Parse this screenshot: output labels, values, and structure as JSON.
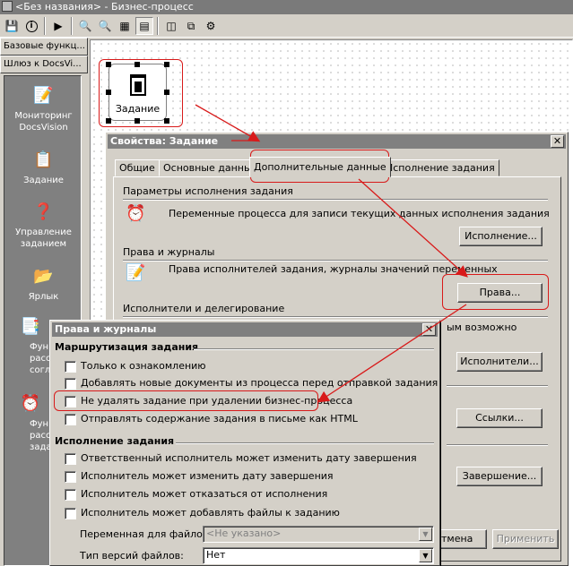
{
  "window": {
    "title": "<Без названия> - Бизнес-процесс"
  },
  "toolbar": {
    "buttons": [
      "save-icon",
      "info-icon",
      "run-icon",
      "zoom-in-icon",
      "zoom-out-icon",
      "fit-icon",
      "page-icon",
      "view-icon",
      "link-icon",
      "tool-icon"
    ]
  },
  "left_tabs": [
    "Базовые функц...",
    "Шлюз к DocsVi..."
  ],
  "palette": [
    {
      "label": "Мониторинг DocsVision",
      "icon": "monitor-icon"
    },
    {
      "label": "Задание",
      "icon": "task-icon"
    },
    {
      "label": "Управление заданием",
      "icon": "manage-task-icon"
    },
    {
      "label": "Ярлык",
      "icon": "shortcut-icon"
    },
    {
      "label": "Функ... рассы... соглас...",
      "icon": "function-icon"
    },
    {
      "label": "Функ... рассы... зада...",
      "icon": "function-clock-icon"
    }
  ],
  "canvas": {
    "shape_label": "Задание"
  },
  "props": {
    "title": "Свойства: Задание",
    "tabs": [
      "Общие",
      "Основные данные",
      "Дополнительные данные",
      "Исполнение задания"
    ],
    "groups": [
      {
        "title": "Параметры исполнения задания",
        "desc": "Переменные процесса для записи текущих данных исполнения задания",
        "button": "Исполнение..."
      },
      {
        "title": "Права и журналы",
        "desc": "Права исполнителей задания, журналы значений переменных",
        "button": "Права..."
      },
      {
        "title": "Исполнители и делегирование",
        "desc": "ым возможно",
        "button": "Исполнители..."
      },
      {
        "button": "Ссылки..."
      },
      {
        "button": "Завершение..."
      }
    ],
    "footer": {
      "cancel": "тмена",
      "apply": "Применить"
    }
  },
  "rights": {
    "title": "Права и журналы",
    "routing_title": "Маршрутизация задания",
    "routing": [
      "Только к ознакомлению",
      "Добавлять новые документы из процесса перед отправкой задания",
      "Не удалять задание при удалении бизнес-процесса",
      "Отправлять содержание задания в письме как HTML"
    ],
    "exec_title": "Исполнение задания",
    "exec": [
      "Ответственный исполнитель может изменить дату завершения",
      "Исполнитель может изменить дату завершения",
      "Исполнитель может отказаться от исполнения",
      "Исполнитель может добавлять файлы к заданию"
    ],
    "files_var_label": "Переменная для файлов:",
    "files_var_value": "<Не указано>",
    "version_type_label": "Тип версий файлов:",
    "version_type_value": "Нет"
  },
  "colors": {
    "highlight": "#d81a1a",
    "window_title_inactive": "#808080",
    "dialog_bg": "#d4d0c8"
  }
}
